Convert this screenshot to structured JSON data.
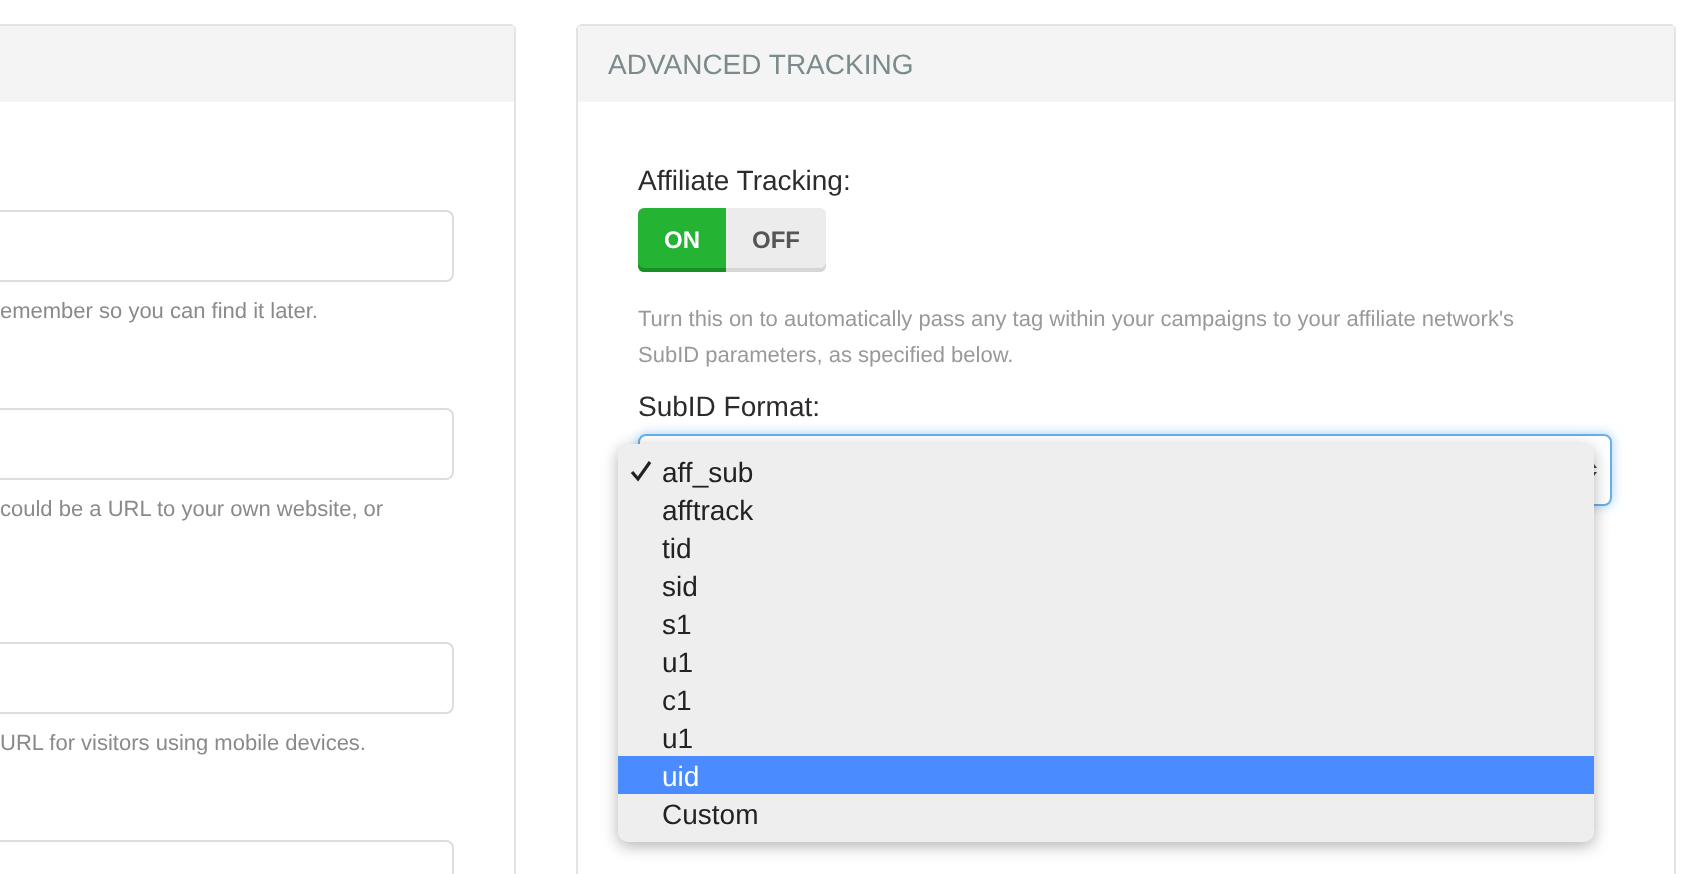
{
  "left_panel": {
    "fields": [
      {
        "help": "emember so you can find it later."
      },
      {
        "help": "could be a URL to your own website, or"
      },
      {
        "help": "URL for visitors using mobile devices."
      }
    ]
  },
  "advanced_panel": {
    "title": "ADVANCED TRACKING",
    "affiliate_tracking": {
      "label": "Affiliate Tracking:",
      "on_label": "ON",
      "off_label": "OFF",
      "on": true,
      "help": "Turn this on to automatically pass any tag within your campaigns to your affiliate network's SubID parameters, as specified below."
    },
    "subid_format": {
      "label": "SubID Format:",
      "options": [
        {
          "label": "aff_sub",
          "selected": true,
          "highlighted": false
        },
        {
          "label": "afftrack",
          "selected": false,
          "highlighted": false
        },
        {
          "label": "tid",
          "selected": false,
          "highlighted": false
        },
        {
          "label": "sid",
          "selected": false,
          "highlighted": false
        },
        {
          "label": "s1",
          "selected": false,
          "highlighted": false
        },
        {
          "label": "u1",
          "selected": false,
          "highlighted": false
        },
        {
          "label": "c1",
          "selected": false,
          "highlighted": false
        },
        {
          "label": "u1",
          "selected": false,
          "highlighted": false
        },
        {
          "label": "uid",
          "selected": false,
          "highlighted": true
        },
        {
          "label": "Custom",
          "selected": false,
          "highlighted": false
        }
      ]
    }
  }
}
